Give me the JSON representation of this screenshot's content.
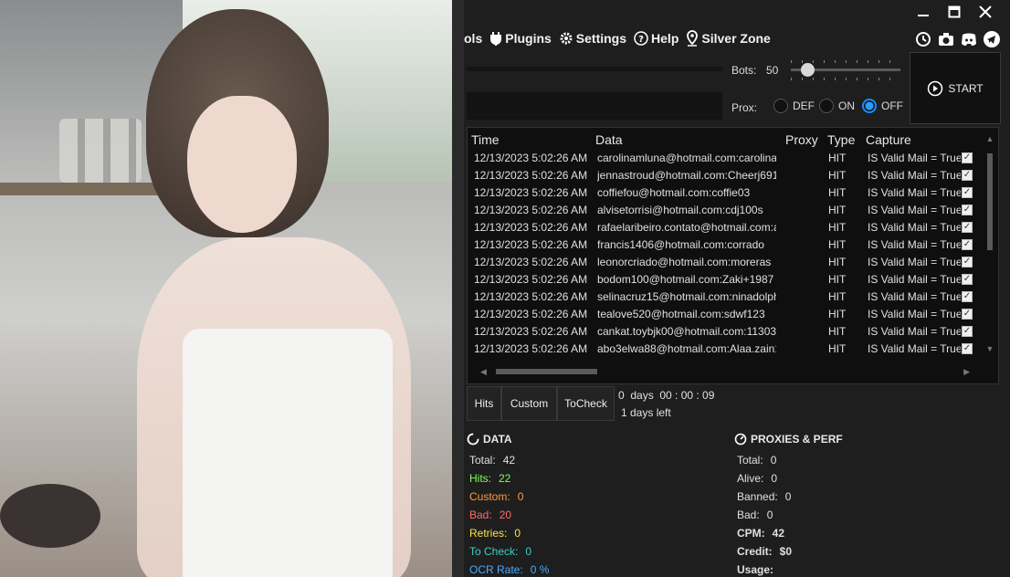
{
  "menu": {
    "partial_label": "ols",
    "items": [
      {
        "label": "Plugins",
        "icon": "plug-icon"
      },
      {
        "label": "Settings",
        "icon": "gear-icon"
      },
      {
        "label": "Help",
        "icon": "help-circle-icon"
      },
      {
        "label": "Silver Zone",
        "icon": "location-pin-icon"
      }
    ]
  },
  "window_controls": [
    "minimize-icon",
    "maximize-icon",
    "close-icon"
  ],
  "tool_icons": [
    "history-icon",
    "camera-icon",
    "discord-icon",
    "telegram-icon"
  ],
  "controls": {
    "bots_label": "Bots:",
    "bots_value": "50",
    "bots_slider_fraction": 0.1,
    "prox_label": "Prox:",
    "prox_options": [
      {
        "label": "DEF",
        "selected": false
      },
      {
        "label": "ON",
        "selected": false
      },
      {
        "label": "OFF",
        "selected": true
      }
    ],
    "start_label": "START"
  },
  "table": {
    "headers": {
      "time": "Time",
      "data": "Data",
      "proxy": "Proxy",
      "type": "Type",
      "capture": "Capture"
    },
    "rows": [
      {
        "time": "12/13/2023 5:02:26 AM",
        "data": "carolinamluna@hotmail.com:carolina",
        "type": "HIT",
        "capture": "IS Valid Mail = True"
      },
      {
        "time": "12/13/2023 5:02:26 AM",
        "data": "jennastroud@hotmail.com:Cheerj691",
        "type": "HIT",
        "capture": "IS Valid Mail = True"
      },
      {
        "time": "12/13/2023 5:02:26 AM",
        "data": "coffiefou@hotmail.com:coffie03",
        "type": "HIT",
        "capture": "IS Valid Mail = True"
      },
      {
        "time": "12/13/2023 5:02:26 AM",
        "data": "alvisetorrisi@hotmail.com:cdj100s",
        "type": "HIT",
        "capture": "IS Valid Mail = True"
      },
      {
        "time": "12/13/2023 5:02:26 AM",
        "data": "rafaelaribeiro.contato@hotmail.com:a",
        "type": "HIT",
        "capture": "IS Valid Mail = True"
      },
      {
        "time": "12/13/2023 5:02:26 AM",
        "data": "francis1406@hotmail.com:corrado",
        "type": "HIT",
        "capture": "IS Valid Mail = True"
      },
      {
        "time": "12/13/2023 5:02:26 AM",
        "data": "leonorcriado@hotmail.com:moreras",
        "type": "HIT",
        "capture": "IS Valid Mail = True"
      },
      {
        "time": "12/13/2023 5:02:26 AM",
        "data": "bodom100@hotmail.com:Zaki+1987",
        "type": "HIT",
        "capture": "IS Valid Mail = True"
      },
      {
        "time": "12/13/2023 5:02:26 AM",
        "data": "selinacruz15@hotmail.com:ninadolph",
        "type": "HIT",
        "capture": "IS Valid Mail = True"
      },
      {
        "time": "12/13/2023 5:02:26 AM",
        "data": "tealove520@hotmail.com:sdwf123",
        "type": "HIT",
        "capture": "IS Valid Mail = True"
      },
      {
        "time": "12/13/2023 5:02:26 AM",
        "data": "cankat.toybjk00@hotmail.com:11303",
        "type": "HIT",
        "capture": "IS Valid Mail = True"
      },
      {
        "time": "12/13/2023 5:02:26 AM",
        "data": "abo3elwa88@hotmail.com:Alaa.zain1",
        "type": "HIT",
        "capture": "IS Valid Mail = True"
      }
    ]
  },
  "tabs": [
    "Hits",
    "Custom",
    "ToCheck"
  ],
  "timer": {
    "elapsed": "0  days  00 : 00 : 09",
    "left": "1 days left"
  },
  "data_section": {
    "title": "DATA",
    "stats": [
      {
        "label": "Total:",
        "value": "42",
        "color": "#e0e0e0"
      },
      {
        "label": "Hits:",
        "value": "22",
        "color": "#7dff5a"
      },
      {
        "label": "Custom:",
        "value": "0",
        "color": "#ff9a3c"
      },
      {
        "label": "Bad:",
        "value": "20",
        "color": "#ff6b6b"
      },
      {
        "label": "Retries:",
        "value": "0",
        "color": "#ffe14a"
      },
      {
        "label": "To Check:",
        "value": "0",
        "color": "#3ad1c7"
      },
      {
        "label": "OCR Rate:",
        "value": "0 %",
        "color": "#4aa8ff"
      }
    ]
  },
  "proxies_section": {
    "title": "PROXIES & PERF",
    "stats": [
      {
        "label": "Total:",
        "value": "0",
        "bold": false
      },
      {
        "label": "Alive:",
        "value": "0",
        "bold": false
      },
      {
        "label": "Banned:",
        "value": "0",
        "bold": false
      },
      {
        "label": "Bad:",
        "value": "0",
        "bold": false
      },
      {
        "label": "CPM:",
        "value": "42",
        "bold": true
      },
      {
        "label": "Credit:",
        "value": "$0",
        "bold": true
      },
      {
        "label": "Usage:",
        "value": "",
        "bold": true
      }
    ]
  }
}
